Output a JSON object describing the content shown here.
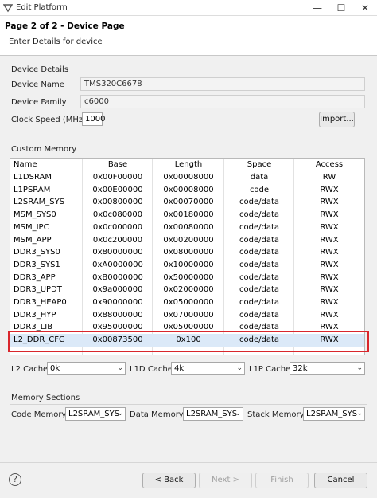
{
  "window": {
    "title": "Edit Platform",
    "min_label": "—",
    "max_label": "☐",
    "close_label": "✕"
  },
  "header": {
    "title": "Page 2 of 2 - Device Page",
    "description": "Enter Details for device"
  },
  "device_details": {
    "group_label": "Device Details",
    "name_label": "Device Name",
    "name_value": "TMS320C6678",
    "family_label": "Device Family",
    "family_value": "c6000",
    "clock_label": "Clock Speed (MHz)",
    "clock_value": "1000",
    "import_label": "Import..."
  },
  "custom_memory": {
    "group_label": "Custom Memory",
    "columns": [
      "Name",
      "Base",
      "Length",
      "Space",
      "Access"
    ],
    "rows": [
      [
        "L1DSRAM",
        "0x00F00000",
        "0x00008000",
        "data",
        "RW"
      ],
      [
        "L1PSRAM",
        "0x00E00000",
        "0x00008000",
        "code",
        "RWX"
      ],
      [
        "L2SRAM_SYS",
        "0x00800000",
        "0x00070000",
        "code/data",
        "RWX"
      ],
      [
        "MSM_SYS0",
        "0x0c080000",
        "0x00180000",
        "code/data",
        "RWX"
      ],
      [
        "MSM_IPC",
        "0x0c000000",
        "0x00080000",
        "code/data",
        "RWX"
      ],
      [
        "MSM_APP",
        "0x0c200000",
        "0x00200000",
        "code/data",
        "RWX"
      ],
      [
        "DDR3_SYS0",
        "0x80000000",
        "0x08000000",
        "code/data",
        "RWX"
      ],
      [
        "DDR3_SYS1",
        "0xA0000000",
        "0x10000000",
        "code/data",
        "RWX"
      ],
      [
        "DDR3_APP",
        "0xB0000000",
        "0x50000000",
        "code/data",
        "RWX"
      ],
      [
        "DDR3_UPDT",
        "0x9a000000",
        "0x02000000",
        "code/data",
        "RWX"
      ],
      [
        "DDR3_HEAP0",
        "0x90000000",
        "0x05000000",
        "code/data",
        "RWX"
      ],
      [
        "DDR3_HYP",
        "0x88000000",
        "0x07000000",
        "code/data",
        "RWX"
      ],
      [
        "DDR3_LIB",
        "0x95000000",
        "0x05000000",
        "code/data",
        "RWX"
      ],
      [
        "L2_DDR_CFG",
        "0x00873500",
        "0x100",
        "code/data",
        "RWX"
      ]
    ]
  },
  "caches": {
    "l2_label": "L2 Cache:",
    "l2_value": "0k",
    "l1d_label": "L1D Cache:",
    "l1d_value": "4k",
    "l1p_label": "L1P Cache:",
    "l1p_value": "32k"
  },
  "memory_sections": {
    "group_label": "Memory Sections",
    "code_label": "Code Memory:",
    "code_value": "L2SRAM_SYS",
    "data_label": "Data Memory:",
    "data_value": "L2SRAM_SYS",
    "stack_label": "Stack Memory:",
    "stack_value": "L2SRAM_SYS"
  },
  "footer": {
    "help_label": "?",
    "back_label": "< Back",
    "next_label": "Next >",
    "finish_label": "Finish",
    "cancel_label": "Cancel"
  },
  "colors": {
    "highlight": "#d9262c",
    "selected_row": "#dbe9f8"
  }
}
